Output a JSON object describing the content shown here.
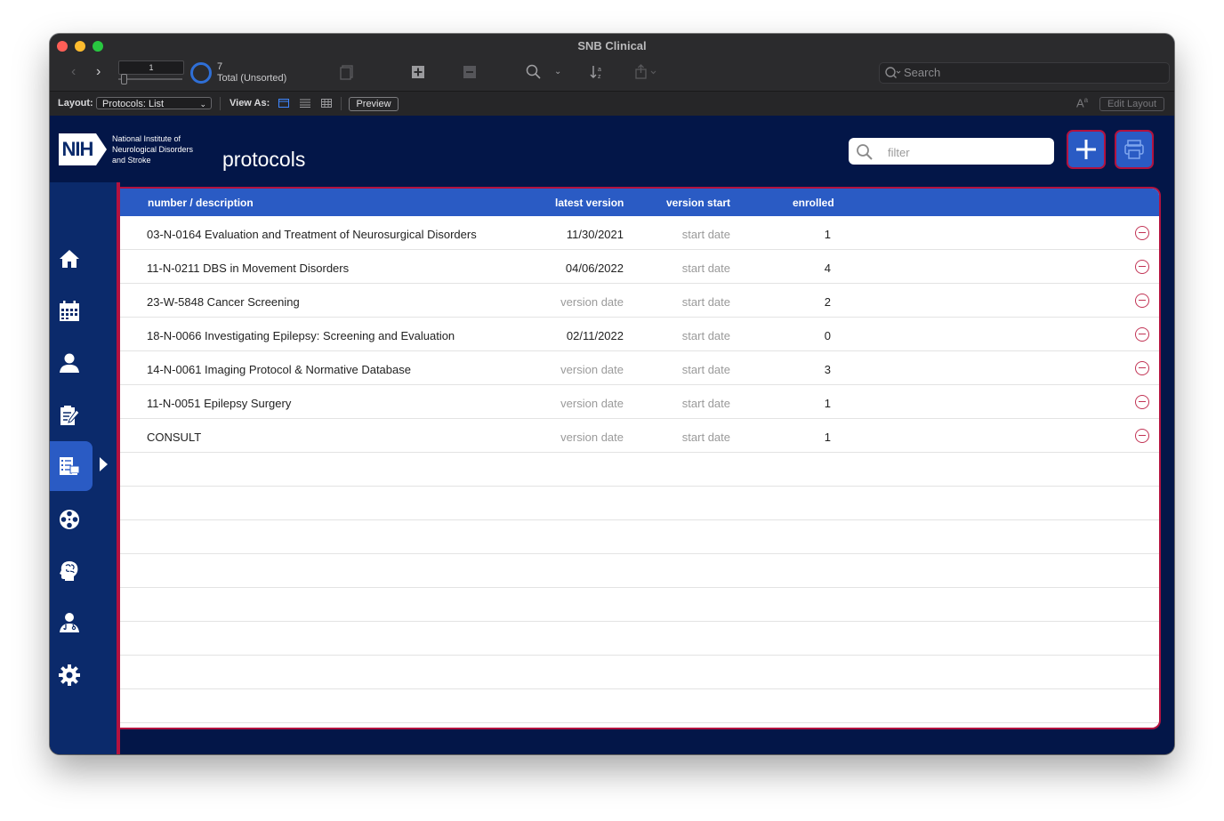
{
  "window": {
    "title": "SNB Clinical"
  },
  "toolbar": {
    "record_number": "1",
    "record_count": "7",
    "record_status": "Total (Unsorted)",
    "search_placeholder": "Search"
  },
  "layout_bar": {
    "layout_label": "Layout:",
    "layout_value": "Protocols: List",
    "view_as_label": "View As:",
    "preview_label": "Preview",
    "edit_layout_label": "Edit Layout"
  },
  "header": {
    "logo_text": "NIH",
    "institute_lines": [
      "National Institute of",
      "Neurological Disorders",
      "and Stroke"
    ],
    "page_title": "protocols",
    "filter_placeholder": "filter"
  },
  "sidebar": {
    "items": [
      {
        "name": "home-icon"
      },
      {
        "name": "calendar-icon"
      },
      {
        "name": "person-icon"
      },
      {
        "name": "clipboard-icon"
      },
      {
        "name": "protocols-icon",
        "active": true
      },
      {
        "name": "film-reel-icon"
      },
      {
        "name": "brain-head-icon"
      },
      {
        "name": "doctor-icon"
      },
      {
        "name": "gear-icon"
      }
    ]
  },
  "table": {
    "columns": [
      "number / description",
      "latest version",
      "version start",
      "enrolled"
    ],
    "rows": [
      {
        "description": "03-N-0164 Evaluation and Treatment of Neurosurgical Disorders",
        "latest_version": "11/30/2021",
        "version_start": "start date",
        "enrolled": "1"
      },
      {
        "description": "11-N-0211 DBS in Movement Disorders",
        "latest_version": "04/06/2022",
        "version_start": "start date",
        "enrolled": "4"
      },
      {
        "description": "23-W-5848 Cancer Screening",
        "latest_version": "version date",
        "version_start": "start date",
        "enrolled": "2"
      },
      {
        "description": "18-N-0066 Investigating Epilepsy: Screening and Evaluation",
        "latest_version": "02/11/2022",
        "version_start": "start date",
        "enrolled": "0"
      },
      {
        "description": "14-N-0061 Imaging Protocol & Normative Database",
        "latest_version": "version date",
        "version_start": "start date",
        "enrolled": "3"
      },
      {
        "description": "11-N-0051 Epilepsy Surgery",
        "latest_version": "version date",
        "version_start": "start date",
        "enrolled": "1"
      },
      {
        "description": "CONSULT",
        "latest_version": "version date",
        "version_start": "start date",
        "enrolled": "1"
      }
    ],
    "placeholder_values": [
      "version date",
      "start date"
    ]
  },
  "colors": {
    "background": "#031648",
    "accent_blue": "#2a5bc4",
    "accent_red": "#b3123f",
    "sidebar": "#0b2a6b"
  }
}
